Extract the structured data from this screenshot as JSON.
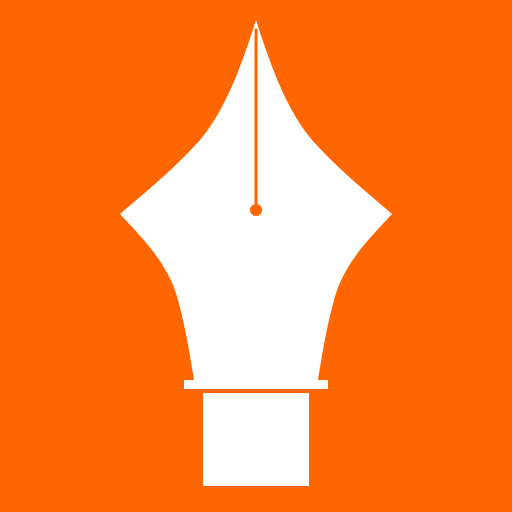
{
  "icon": {
    "name": "pen-nib-icon",
    "background_color": "#ff6600",
    "foreground_color": "#ffffff"
  }
}
